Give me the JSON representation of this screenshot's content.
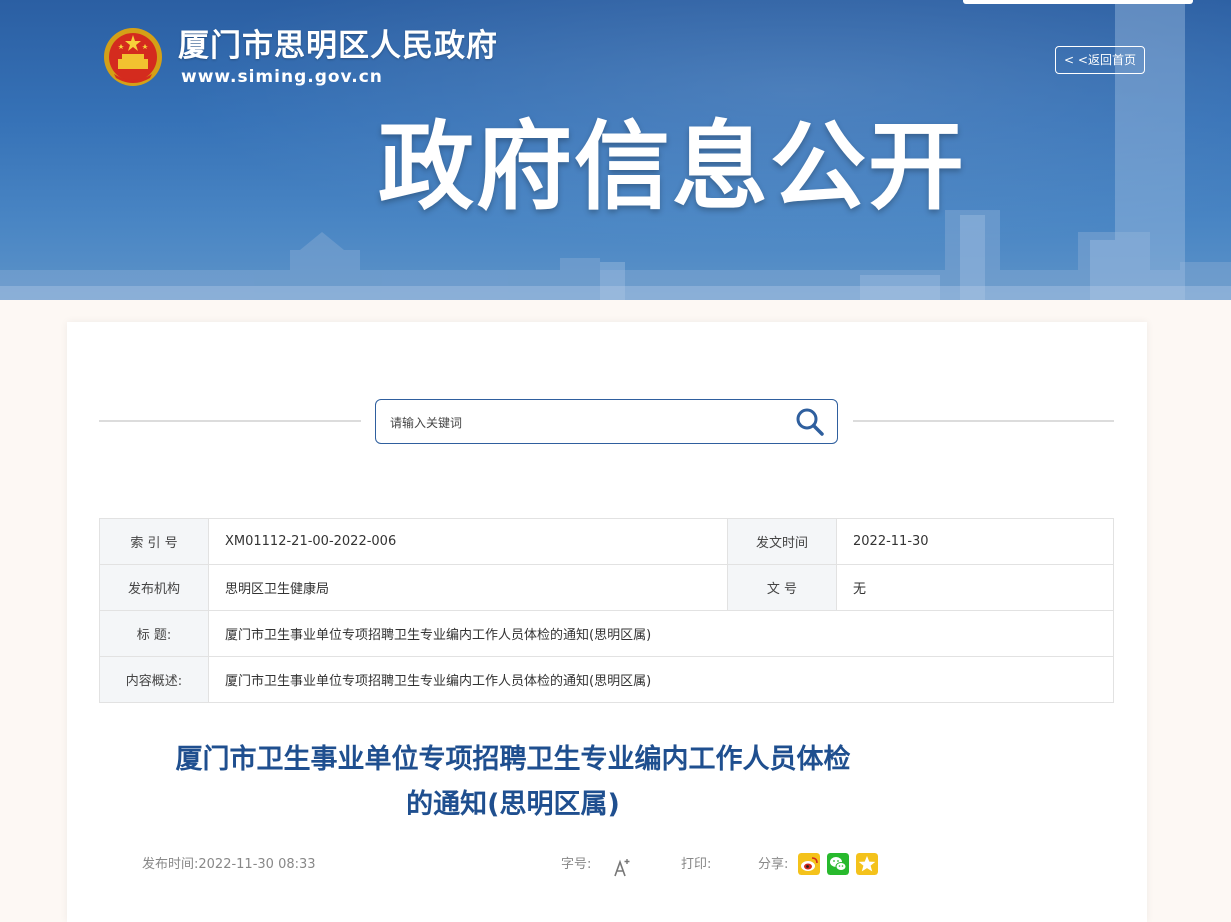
{
  "header": {
    "site_name": "厦门市思明区人民政府",
    "site_url": "www.siming.gov.cn",
    "back_home": "< <返回首页",
    "banner_title": "政府信息公开"
  },
  "search": {
    "placeholder": "请输入关键词"
  },
  "info_table": {
    "index_label": "索 引 号",
    "index_value": "XM01112-21-00-2022-006",
    "date_label": "发文时间",
    "date_value": "2022-11-30",
    "org_label": "发布机构",
    "org_value": "思明区卫生健康局",
    "docno_label": "文 号",
    "docno_value": "无",
    "title_label": "标 题:",
    "title_value": "厦门市卫生事业单位专项招聘卫生专业编内工作人员体检的通知(思明区属)",
    "summary_label": "内容概述:",
    "summary_value": "厦门市卫生事业单位专项招聘卫生专业编内工作人员体检的通知(思明区属)"
  },
  "article": {
    "title_line1": "厦门市卫生事业单位专项招聘卫生专业编内工作人员体检",
    "title_line2": "的通知(思明区属)",
    "publish_label": "发布时间:",
    "publish_time": "2022-11-30 08:33",
    "font_size_label": "字号:",
    "print_label": "打印:",
    "share_label": "分享:"
  },
  "icons": {
    "search": "search-icon",
    "font_size": "font-size-icon",
    "weibo": "weibo-icon",
    "wechat": "wechat-icon",
    "favorite": "favorite-star-icon"
  },
  "colors": {
    "banner_blue": "#2b5fa3",
    "title_blue": "#1f4f8f",
    "weibo_bg": "#f4c21b",
    "wechat_bg": "#28b92d",
    "favorite_bg": "#f4c21b"
  }
}
